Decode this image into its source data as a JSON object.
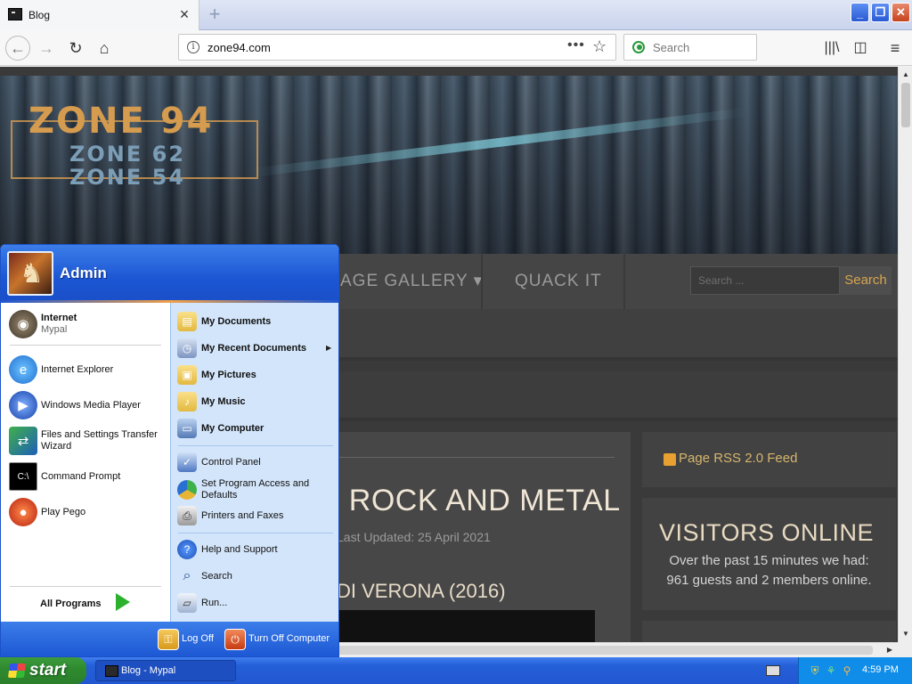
{
  "browser": {
    "tab_title": "Blog",
    "tab_close": "×",
    "new_tab": "+",
    "url": "zone94.com",
    "url_more": "•••",
    "search_placeholder": "Search",
    "window_minimize": "_",
    "window_restore": "❐",
    "window_close": "✕"
  },
  "site": {
    "logo_main": "ZONE 94",
    "logo_sub1": "ZONE 62",
    "logo_sub2": "ZONE 54",
    "menu": [
      {
        "label": "AGE GALLERY ▾"
      },
      {
        "label": "QUACK IT"
      }
    ],
    "search_placeholder": "Search ...",
    "search_button": "Search",
    "article_title": "- ROCK AND METAL",
    "article_date": "Last Updated: 25 April 2021",
    "article_subtitle": "DI VERONA (2016)",
    "rss_label": "Page RSS 2.0 Feed",
    "visitors_title": "VISITORS ONLINE",
    "visitors_line1": "Over the past 15 minutes we had:",
    "visitors_line2": "961 guests and 2 members online."
  },
  "start_menu": {
    "user": "Admin",
    "pinned": [
      {
        "label": "Internet",
        "sub": "Mypal",
        "icon": "raccoon-icon"
      }
    ],
    "recent": [
      {
        "label": "Internet Explorer",
        "icon": "ie-icon"
      },
      {
        "label": "Windows Media Player",
        "icon": "media-player-icon"
      },
      {
        "label_line1": "Files and Settings Transfer",
        "label_line2": "Wizard",
        "icon": "transfer-wizard-icon"
      },
      {
        "label": "Command Prompt",
        "icon": "cmd-icon"
      },
      {
        "label": "Play Pego",
        "icon": "pego-icon"
      }
    ],
    "all_programs": "All Programs",
    "right_bold": [
      {
        "label": "My Documents",
        "icon": "folder-documents-icon"
      },
      {
        "label": "My Recent Documents",
        "icon": "recent-documents-icon"
      },
      {
        "label": "My Pictures",
        "icon": "folder-pictures-icon"
      },
      {
        "label": "My Music",
        "icon": "folder-music-icon"
      },
      {
        "label": "My Computer",
        "icon": "computer-icon"
      }
    ],
    "right_plain": [
      {
        "label": "Control Panel",
        "icon": "control-panel-icon"
      },
      {
        "label_line1": "Set Program Access and",
        "label_line2": "Defaults",
        "icon": "program-access-icon"
      },
      {
        "label": "Printers and Faxes",
        "icon": "printer-icon"
      },
      {
        "label": "Help and Support",
        "icon": "help-icon"
      },
      {
        "label": "Search",
        "icon": "search-icon"
      },
      {
        "label": "Run...",
        "icon": "run-icon"
      }
    ],
    "log_off": "Log Off",
    "turn_off": "Turn Off Computer"
  },
  "taskbar": {
    "start_label": "start",
    "task_label": "Blog - Mypal",
    "clock": "4:59 PM"
  }
}
